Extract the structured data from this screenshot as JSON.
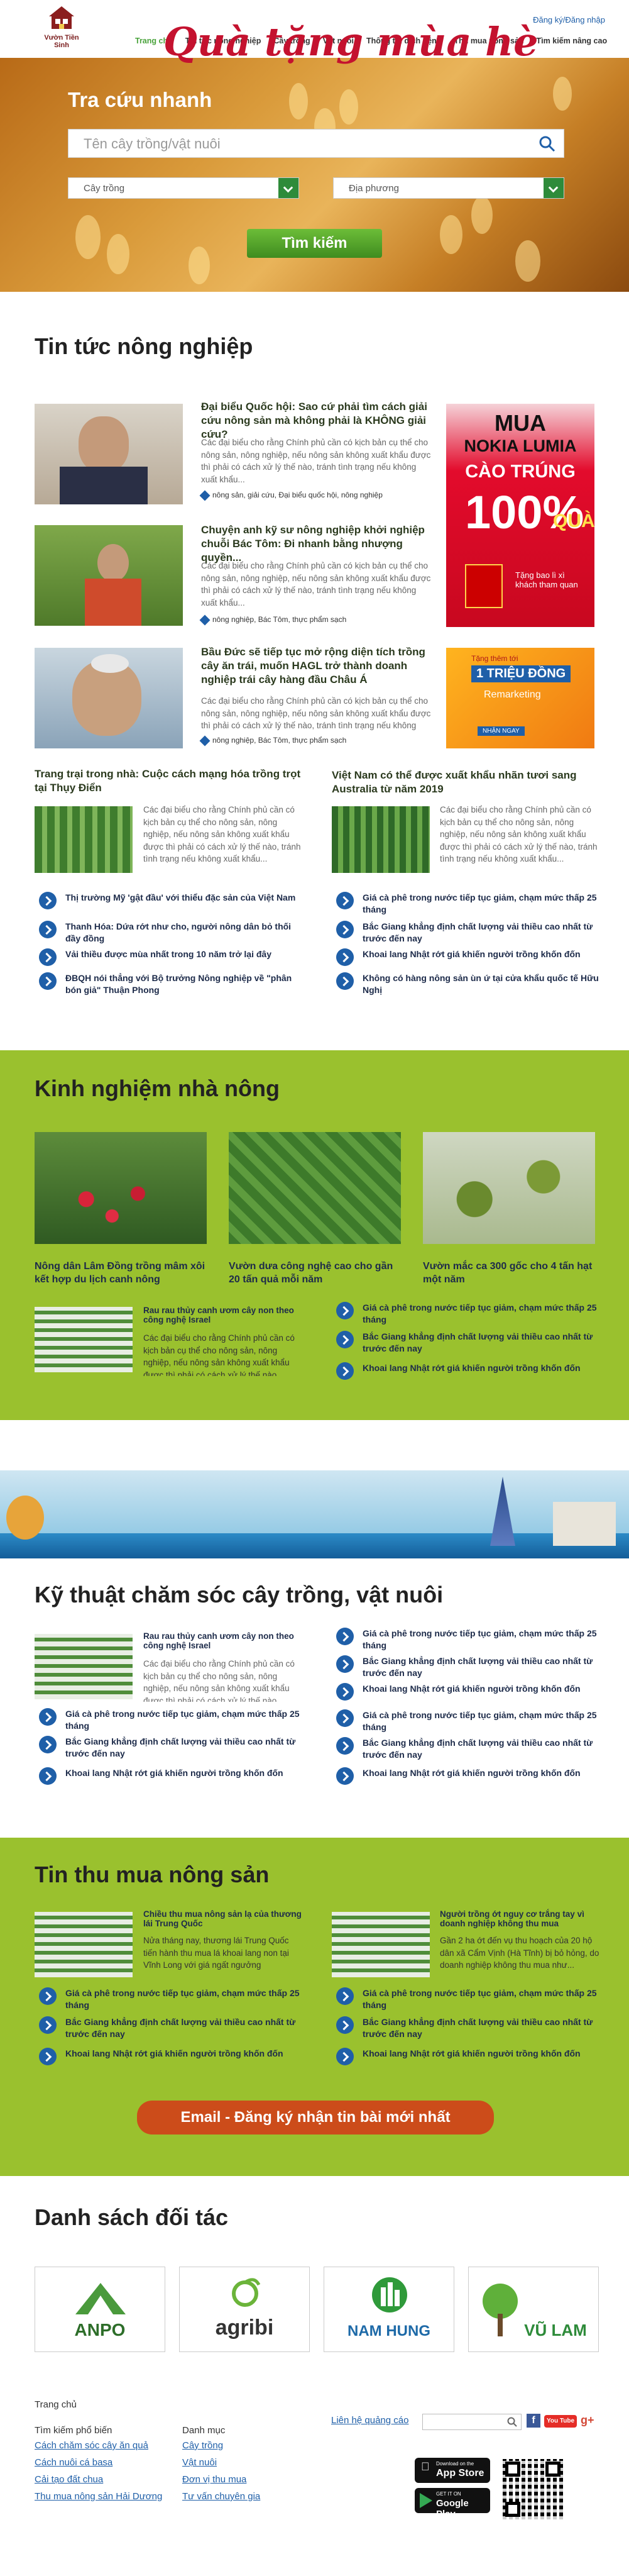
{
  "header": {
    "logo_text": "Vườn Tiền Sinh",
    "login_label": "Đăng ký/Đăng nhập",
    "nav": [
      "Trang chủ",
      "Tin tức nông nghiệp",
      "Cây trồng",
      "Vật nuôi",
      "Thông tin dịch bệnh",
      "Thu mua nông sản",
      "Tìm kiếm nâng cao"
    ]
  },
  "hero": {
    "title": "Tra cứu nhanh",
    "search_placeholder": "Tên cây trồng/vật nuôi",
    "select1": "Cây trồng",
    "select2": "Địa phương",
    "button": "Tìm kiếm"
  },
  "news": {
    "title": "Tin tức nông nghiệp",
    "items": [
      {
        "title": "Đại biểu Quốc hội: Sao cứ phải tìm cách giải cứu nông sản mà không phải là KHÔNG giải cứu?",
        "desc": "Các đại biểu cho rằng Chính phủ cần có kịch bản cụ thể cho nông sản, nông nghiệp, nếu nông sản không xuất khẩu được thì phải có cách xử lý thế nào, tránh tình trạng nếu không xuất khẩu...",
        "tags": "nông sản, giải cứu, Đại biểu quốc hội, nông nghiệp"
      },
      {
        "title": "Chuyện anh kỹ sư nông nghiệp khởi nghiệp chuỗi Bác Tôm: Đi nhanh bằng nhượng quyền...",
        "desc": "Các đại biểu cho rằng Chính phủ cần có kịch bản cụ thể cho nông sản, nông nghiệp, nếu nông sản không xuất khẩu được thì phải có cách xử lý thế nào, tránh tình trạng nếu không xuất khẩu...",
        "tags": "nông nghiệp, Bác Tôm, thực phẩm sạch"
      },
      {
        "title": "Bầu Đức sẽ tiếp tục mở rộng diện tích trồng cây ăn trái, muốn HAGL trở thành doanh nghiệp trái cây hàng đầu Châu Á",
        "desc": "Các đại biểu cho rằng Chính phủ cần có kịch bản cụ thể cho nông sản, nông nghiệp, nếu nông sản không xuất khẩu được thì phải có cách xử lý thế nào, tránh tình trạng nếu không xuất khẩu...",
        "tags": "nông nghiệp, Bác Tôm, thực phẩm sạch"
      }
    ],
    "ad1": {
      "l1": "MUA",
      "l2": "NOKIA LUMIA",
      "l3": "CÀO TRÚNG",
      "l4": "100%",
      "l5": "QUÀ",
      "l6": "Tặng bao lì xì khách tham quan"
    },
    "ad2": {
      "l1": "Tặng thêm tới",
      "l2": "1 TRIỆU ĐỒNG",
      "l3": "Remarketing",
      "l4": "NHẬN NGAY"
    },
    "col_left": {
      "title": "Trang trại trong nhà: Cuộc cách mạng hóa trồng trọt tại Thụy Điển",
      "desc": "Các đại biểu cho rằng Chính phủ cần có kịch bản cụ thể cho nông sản, nông nghiệp, nếu nông sản không xuất khẩu được thì phải có cách xử lý thế nào, tránh tình trạng nếu không xuất khẩu..."
    },
    "col_right": {
      "title": "Việt Nam có thể được xuất khẩu nhãn tươi sang Australia từ năm 2019",
      "desc": "Các đại biểu cho rằng Chính phủ cần có kịch bản cụ thể cho nông sản, nông nghiệp, nếu nông sản không xuất khẩu được thì phải có cách xử lý thế nào, tránh tình trạng nếu không xuất khẩu..."
    },
    "list_left": [
      "Thị trường Mỹ 'gật đầu' với thiểu đặc sản của Việt Nam",
      "Thanh Hóa: Dứa rớt như cho, người nông dân bỏ thối đầy đồng",
      "Vải thiều được mùa nhất trong 10 năm trở lại đây",
      "ĐBQH nói thẳng với Bộ trưởng Nông nghiệp về \"phân bón giả\" Thuận Phong"
    ],
    "list_right": [
      "Giá cà phê trong nước tiếp tục giảm, chạm mức thấp 25 tháng",
      "Bắc Giang khẳng định chất lượng vải thiều cao nhất từ trước đến nay",
      "Khoai lang Nhật rớt giá khiến người trồng khốn đốn",
      "Không có hàng nông sản ùn ứ tại cửa khẩu quốc tế Hữu Nghị"
    ]
  },
  "exp": {
    "title": "Kinh nghiệm nhà nông",
    "cards": [
      {
        "caption": "Nông dân Lâm Đồng trồng mâm xôi kết hợp du lịch canh nông"
      },
      {
        "caption": "Vườn dưa công nghệ cao cho gần 20 tấn quả mỗi năm"
      },
      {
        "caption": "Vườn mắc ca 300 gốc cho 4 tấn hạt một năm"
      }
    ],
    "feat": {
      "title": "Rau rau thủy canh ươm cây non theo công nghệ Israel",
      "desc": "Các đại biểu cho rằng Chính phủ cần có kịch bản cụ thể cho nông sản, nông nghiệp, nếu nông sản không xuất khẩu được thì phải có cách xử lý thế nào..."
    },
    "list": [
      "Giá cà phê trong nước tiếp tục giảm, chạm mức thấp 25 tháng",
      "Bắc Giang khẳng định chất lượng vải thiều cao nhất từ trước đến nay",
      "Khoai lang Nhật rớt giá khiến người trồng khốn đốn"
    ]
  },
  "promo": {
    "text": "Quà tặng mùa hè"
  },
  "care": {
    "title": "Kỹ thuật chăm sóc cây trồng, vật nuôi",
    "feat": {
      "title": "Rau rau thủy canh ươm cây non theo công nghệ Israel",
      "desc": "Các đại biểu cho rằng Chính phủ cần có kịch bản cụ thể cho nông sản, nông nghiệp, nếu nông sản không xuất khẩu được thì phải có cách xử lý thế nào..."
    },
    "list_left": [
      "Giá cà phê trong nước tiếp tục giảm, chạm mức thấp 25 tháng",
      "Bắc Giang khẳng định chất lượng vải thiều cao nhất từ trước đến nay",
      "Khoai lang Nhật rớt giá khiến người trồng khốn đốn"
    ],
    "list_right": [
      "Giá cà phê trong nước tiếp tục giảm, chạm mức thấp 25 tháng",
      "Bắc Giang khẳng định chất lượng vải thiều cao nhất từ trước đến nay",
      "Khoai lang Nhật rớt giá khiến người trồng khốn đốn",
      "Giá cà phê trong nước tiếp tục giảm, chạm mức thấp 25 tháng",
      "Bắc Giang khẳng định chất lượng vải thiều cao nhất từ trước đến nay",
      "Khoai lang Nhật rớt giá khiến người trồng khốn đốn"
    ]
  },
  "buy": {
    "title": "Tin thu mua nông sản",
    "feat_left": {
      "title": "Chiều thu mua nông sản lạ của thương lái Trung Quốc",
      "desc": "Nửa tháng nay, thương lái Trung Quốc tiến hành thu mua lá khoai lang non tại Vĩnh Long với giá ngất ngưởng"
    },
    "feat_right": {
      "title": "Người trồng ớt nguy cơ trắng tay vì doanh nghiệp không thu mua",
      "desc": "Gần 2 ha ớt đến vụ thu hoạch của 20 hộ dân xã Cẩm Vịnh (Hà Tĩnh) bị bỏ hỏng, do doanh nghiệp không thu mua như..."
    },
    "list": [
      "Giá cà phê trong nước tiếp tục giảm, chạm mức thấp 25 tháng",
      "Bắc Giang khẳng định chất lượng vải thiều cao nhất từ trước đến nay",
      "Khoai lang Nhật rớt giá khiến người trồng khốn đốn"
    ],
    "email_btn": "Email - Đăng ký nhận tin bài  mới nhất"
  },
  "partners": {
    "title": "Danh sách đối tác",
    "names": [
      "ANPO",
      "agribi",
      "NAM HUNG",
      "VŨ LAM"
    ]
  },
  "footer": {
    "home": "Trang chủ",
    "col1_title": "Tìm kiếm phổ biến",
    "col1": [
      "Cách chăm sóc cây ăn quả",
      "Cách nuôi cá basa",
      "Cải tạo đất chua",
      "Thu mua nông sản Hải Dương"
    ],
    "col2_title": "Danh mục",
    "col2": [
      "Cây trồng",
      "Vật nuôi",
      "Đơn vị thu mua",
      "Tư vấn chuyên gia"
    ],
    "ad_link": "Liên hệ quảng cáo",
    "social": [
      "f",
      "You Tube",
      "g+"
    ],
    "appstore": "App Store",
    "appstore_pre": "Download on the",
    "gplay": "Google Play",
    "gplay_pre": "GET IT ON"
  }
}
